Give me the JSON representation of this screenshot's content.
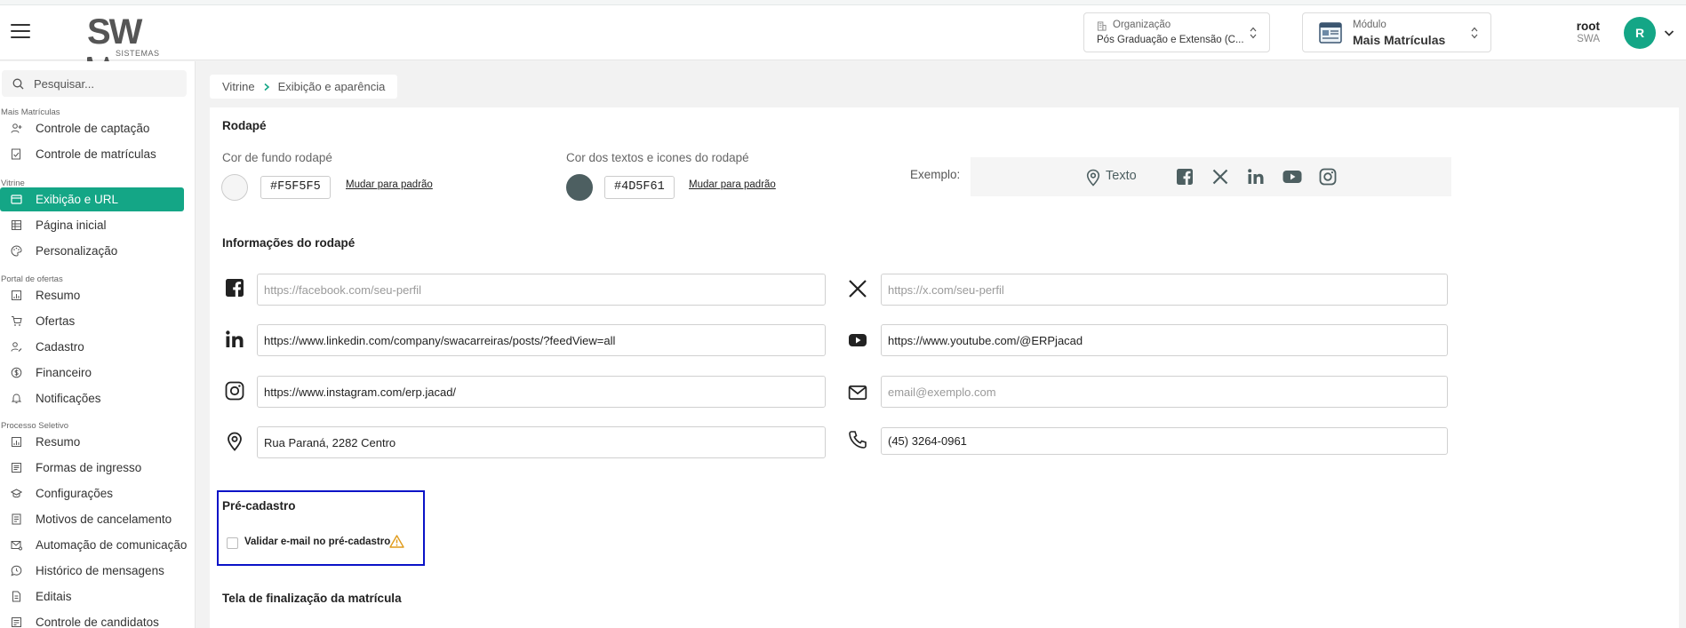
{
  "header": {
    "logo_text": "SW",
    "logo_sub": "SISTEMAS",
    "organization": {
      "label": "Organização",
      "value": "Pós Graduação e Extensão (C..."
    },
    "module": {
      "label": "Módulo",
      "value": "Mais Matrículas"
    },
    "user": {
      "name": "root",
      "org": "SWA",
      "initial": "R"
    }
  },
  "sidebar": {
    "search_placeholder": "Pesquisar...",
    "sections": [
      {
        "label": "Mais Matrículas",
        "items": [
          "Controle de captação",
          "Controle de matrículas"
        ]
      },
      {
        "label": "Vitrine",
        "items": [
          "Exibição e URL",
          "Página inicial",
          "Personalização"
        ]
      },
      {
        "label": "Portal de ofertas",
        "items": [
          "Resumo",
          "Ofertas",
          "Cadastro",
          "Financeiro",
          "Notificações"
        ]
      },
      {
        "label": "Processo Seletivo",
        "items": [
          "Resumo",
          "Formas de ingresso",
          "Configurações",
          "Motivos de cancelamento",
          "Automação de comunicação",
          "Histórico de mensagens",
          "Editais",
          "Controle de candidatos"
        ]
      }
    ]
  },
  "breadcrumb": {
    "root": "Vitrine",
    "current": "Exibição e aparência"
  },
  "footer_section": {
    "title": "Rodapé",
    "bg_color": {
      "label": "Cor de fundo rodapé",
      "hex": "#F5F5F5",
      "reset": "Mudar para padrão"
    },
    "text_color": {
      "label": "Cor dos textos e icones do rodapé",
      "hex": "#4D5F61",
      "reset": "Mudar para padrão"
    },
    "example": {
      "label": "Exemplo:",
      "text": "Texto"
    }
  },
  "footer_info": {
    "title": "Informações do rodapé",
    "facebook": {
      "value": "",
      "placeholder": "https://facebook.com/seu-perfil"
    },
    "x": {
      "value": "",
      "placeholder": "https://x.com/seu-perfil"
    },
    "linkedin": {
      "value": "https://www.linkedin.com/company/swacarreiras/posts/?feedView=all",
      "placeholder": ""
    },
    "youtube": {
      "value": "https://www.youtube.com/@ERPjacad",
      "placeholder": ""
    },
    "instagram": {
      "value": "https://www.instagram.com/erp.jacad/",
      "placeholder": ""
    },
    "email": {
      "value": "",
      "placeholder": "email@exemplo.com"
    },
    "address": {
      "value": "Rua Paraná, 2282 Centro",
      "placeholder": ""
    },
    "phone": {
      "value": "(45) 3264-0961",
      "placeholder": ""
    }
  },
  "pre_cadastro": {
    "title": "Pré-cadastro",
    "validate_email_label": "Validar e-mail no pré-cadastro",
    "validate_email_checked": false
  },
  "finalization": {
    "title": "Tela de finalização da matrícula"
  },
  "colors": {
    "accent": "#14a686",
    "highlight": "#0a13c7",
    "footer_bg": "#F5F5F5",
    "footer_text": "#4D5F61"
  }
}
